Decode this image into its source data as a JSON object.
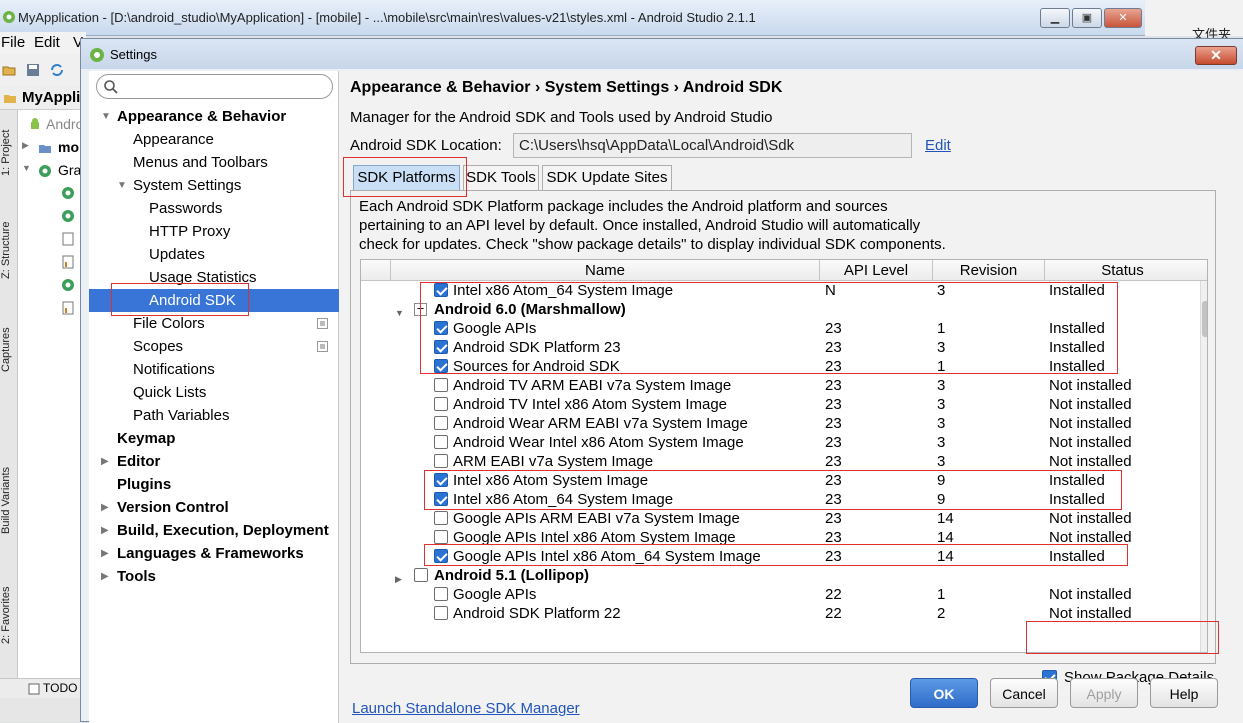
{
  "ide": {
    "title": "MyApplication - [D:\\android_studio\\MyApplication] - [mobile] - ...\\mobile\\src\\main\\res\\values-v21\\styles.xml - Android Studio 2.1.1",
    "menu_file": "File",
    "menu_edit": "Edit",
    "menu_view": "V",
    "project_title": "MyAppli",
    "tree_android": "Andro",
    "tree_mod": "mo",
    "tree_gradle": "Gra",
    "strip_project": "1: Project",
    "strip_structure": "Z: Structure",
    "strip_captures": "Captures",
    "strip_build_variants": "Build Variants",
    "strip_favorites": "2: Favorites",
    "bottom_todo": "TODO",
    "desktop_text": "文件夹"
  },
  "dialog": {
    "title": "Settings",
    "search": {
      "placeholder": "",
      "value": ""
    },
    "tree": [
      {
        "label": "Appearance & Behavior",
        "level": 0,
        "bold": true,
        "expanded": true
      },
      {
        "label": "Appearance",
        "level": 1
      },
      {
        "label": "Menus and Toolbars",
        "level": 1
      },
      {
        "label": "System Settings",
        "level": 1,
        "expanded": true
      },
      {
        "label": "Passwords",
        "level": 2
      },
      {
        "label": "HTTP Proxy",
        "level": 2
      },
      {
        "label": "Updates",
        "level": 2
      },
      {
        "label": "Usage Statistics",
        "level": 2
      },
      {
        "label": "Android SDK",
        "level": 2,
        "selected": true
      },
      {
        "label": "File Colors",
        "level": 1,
        "config": true
      },
      {
        "label": "Scopes",
        "level": 1,
        "config": true
      },
      {
        "label": "Notifications",
        "level": 1
      },
      {
        "label": "Quick Lists",
        "level": 1
      },
      {
        "label": "Path Variables",
        "level": 1
      },
      {
        "label": "Keymap",
        "level": 0,
        "bold": true
      },
      {
        "label": "Editor",
        "level": 0,
        "bold": true,
        "collapsed": true
      },
      {
        "label": "Plugins",
        "level": 0,
        "bold": true
      },
      {
        "label": "Version Control",
        "level": 0,
        "bold": true,
        "collapsed": true
      },
      {
        "label": "Build, Execution, Deployment",
        "level": 0,
        "bold": true,
        "collapsed": true
      },
      {
        "label": "Languages & Frameworks",
        "level": 0,
        "bold": true,
        "collapsed": true
      },
      {
        "label": "Tools",
        "level": 0,
        "bold": true,
        "collapsed": true
      }
    ],
    "breadcrumb": "Appearance & Behavior › System Settings › Android SDK",
    "manager_desc": "Manager for the Android SDK and Tools used by Android Studio",
    "sdk_location_label": "Android SDK Location:",
    "sdk_location_value": "C:\\Users\\hsq\\AppData\\Local\\Android\\Sdk",
    "edit_link": "Edit",
    "tabs": [
      "SDK Platforms",
      "SDK Tools",
      "SDK Update Sites"
    ],
    "platform_desc": [
      "Each Android SDK Platform package includes the Android platform and sources",
      "pertaining to an API level by default. Once installed, Android Studio will automatically",
      "check for updates. Check \"show package details\" to display individual SDK components."
    ],
    "table_headers": {
      "name": "Name",
      "api": "API Level",
      "revision": "Revision",
      "status": "Status"
    },
    "rows": [
      {
        "type": "item",
        "checked": true,
        "name": "Intel x86 Atom_64 System Image",
        "api": "N",
        "rev": "3",
        "status": "Installed"
      },
      {
        "type": "group",
        "expanded": true,
        "name": "Android 6.0 (Marshmallow)"
      },
      {
        "type": "item",
        "checked": true,
        "name": "Google APIs",
        "api": "23",
        "rev": "1",
        "status": "Installed"
      },
      {
        "type": "item",
        "checked": true,
        "name": "Android SDK Platform 23",
        "api": "23",
        "rev": "3",
        "status": "Installed"
      },
      {
        "type": "item",
        "checked": true,
        "name": "Sources for Android SDK",
        "api": "23",
        "rev": "1",
        "status": "Installed"
      },
      {
        "type": "item",
        "checked": false,
        "name": "Android TV ARM EABI v7a System Image",
        "api": "23",
        "rev": "3",
        "status": "Not installed"
      },
      {
        "type": "item",
        "checked": false,
        "name": "Android TV Intel x86 Atom System Image",
        "api": "23",
        "rev": "3",
        "status": "Not installed"
      },
      {
        "type": "item",
        "checked": false,
        "name": "Android Wear ARM EABI v7a System Image",
        "api": "23",
        "rev": "3",
        "status": "Not installed"
      },
      {
        "type": "item",
        "checked": false,
        "name": "Android Wear Intel x86 Atom System Image",
        "api": "23",
        "rev": "3",
        "status": "Not installed"
      },
      {
        "type": "item",
        "checked": false,
        "name": "ARM EABI v7a System Image",
        "api": "23",
        "rev": "3",
        "status": "Not installed"
      },
      {
        "type": "item",
        "checked": true,
        "name": "Intel x86 Atom System Image",
        "api": "23",
        "rev": "9",
        "status": "Installed"
      },
      {
        "type": "item",
        "checked": true,
        "name": "Intel x86 Atom_64 System Image",
        "api": "23",
        "rev": "9",
        "status": "Installed"
      },
      {
        "type": "item",
        "checked": false,
        "name": "Google APIs ARM EABI v7a System Image",
        "api": "23",
        "rev": "14",
        "status": "Not installed"
      },
      {
        "type": "item",
        "checked": false,
        "name": "Google APIs Intel x86 Atom System Image",
        "api": "23",
        "rev": "14",
        "status": "Not installed"
      },
      {
        "type": "item",
        "checked": true,
        "name": "Google APIs Intel x86 Atom_64 System Image",
        "api": "23",
        "rev": "14",
        "status": "Installed"
      },
      {
        "type": "group",
        "expanded": false,
        "checked": false,
        "name": "Android 5.1 (Lollipop)"
      },
      {
        "type": "item",
        "checked": false,
        "name": "Google APIs",
        "api": "22",
        "rev": "1",
        "status": "Not installed"
      },
      {
        "type": "item",
        "checked": false,
        "name": "Android SDK Platform 22",
        "api": "22",
        "rev": "2",
        "status": "Not installed"
      }
    ],
    "show_package_details": {
      "label": "Show Package Details",
      "checked": true
    },
    "launch_link": "Launch Standalone SDK Manager",
    "buttons": {
      "ok": "OK",
      "cancel": "Cancel",
      "apply": "Apply",
      "help": "Help"
    }
  },
  "colors": {
    "selection": "#3875d7",
    "checkbox": "#2b73d2",
    "link": "#2255bb",
    "annotation": "#e03030"
  }
}
